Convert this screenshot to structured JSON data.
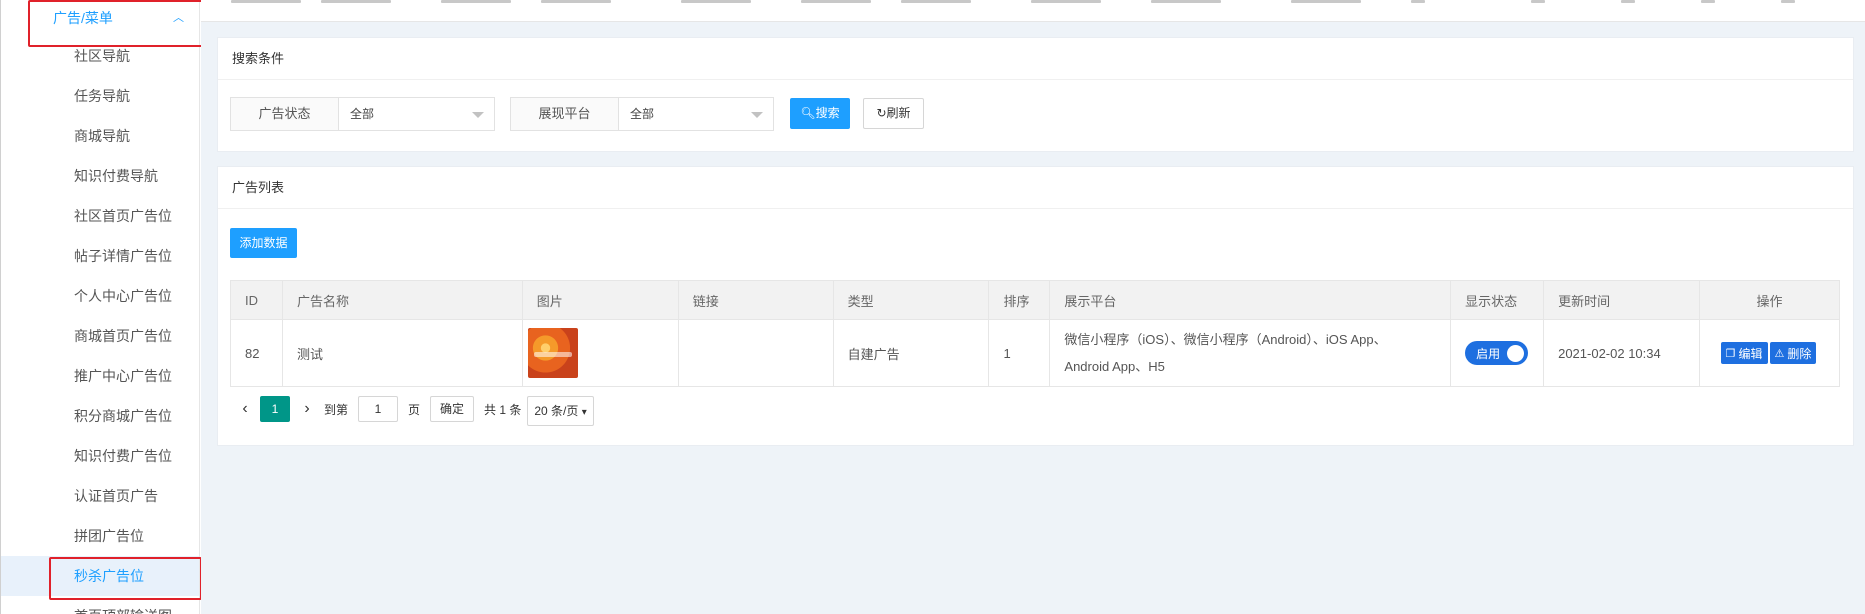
{
  "sidebar": {
    "parent_label": "广告/菜单",
    "items": [
      {
        "label": "社区导航"
      },
      {
        "label": "任务导航"
      },
      {
        "label": "商城导航"
      },
      {
        "label": "知识付费导航"
      },
      {
        "label": "社区首页广告位"
      },
      {
        "label": "帖子详情广告位"
      },
      {
        "label": "个人中心广告位"
      },
      {
        "label": "商城首页广告位"
      },
      {
        "label": "推广中心广告位"
      },
      {
        "label": "积分商城广告位"
      },
      {
        "label": "知识付费广告位"
      },
      {
        "label": "认证首页广告"
      },
      {
        "label": "拼团广告位"
      },
      {
        "label": "秒杀广告位"
      },
      {
        "label": "首页顶部输送图"
      }
    ],
    "active_index": 13
  },
  "search": {
    "title": "搜索条件",
    "status_label": "广告状态",
    "status_value": "全部",
    "platform_label": "展现平台",
    "platform_value": "全部",
    "search_btn": "搜索",
    "refresh_btn": "刷新"
  },
  "list": {
    "title": "广告列表",
    "add_btn": "添加数据",
    "columns": [
      "ID",
      "广告名称",
      "图片",
      "链接",
      "类型",
      "排序",
      "展示平台",
      "显示状态",
      "更新时间",
      "操作"
    ],
    "rows": [
      {
        "id": "82",
        "name": "测试",
        "link": "",
        "type": "自建广告",
        "sort": "1",
        "platform_line1": "微信小程序（iOS）、微信小程序（Android）、iOS App、",
        "platform_line2": "Android App、H5",
        "status": "启用",
        "updated": "2021-02-02 10:34",
        "edit": "编辑",
        "delete": "删除"
      }
    ]
  },
  "pager": {
    "current": "1",
    "goto_label": "到第",
    "goto_value": "1",
    "page_unit": "页",
    "confirm": "确定",
    "total": "共 1 条",
    "per_page": "20 条/页"
  },
  "colors": {
    "accent": "#1E9FFF",
    "highlight": "#e0212a",
    "pager_active": "#009688"
  }
}
